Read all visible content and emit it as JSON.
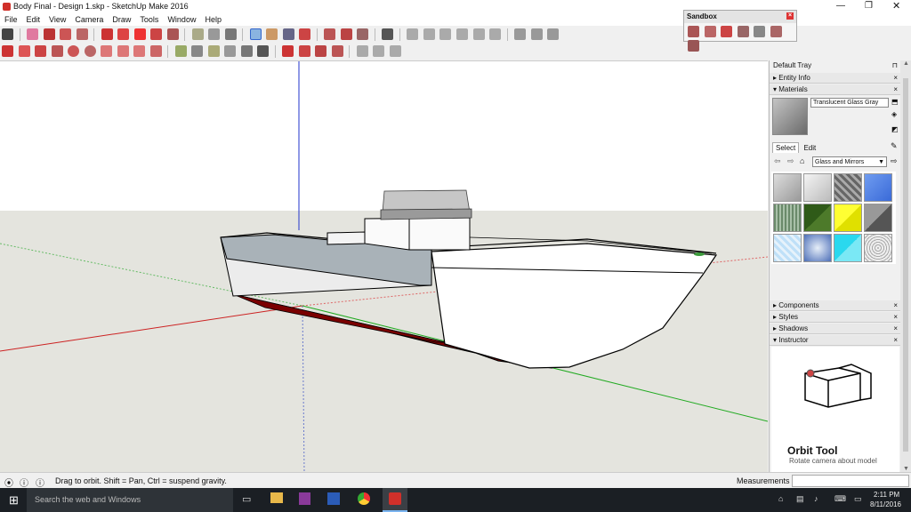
{
  "window": {
    "title": "Body Final - Design 1.skp - SketchUp Make 2016"
  },
  "menu": [
    "File",
    "Edit",
    "View",
    "Camera",
    "Draw",
    "Tools",
    "Window",
    "Help"
  ],
  "sandbox": {
    "title": "Sandbox"
  },
  "tray": {
    "title": "Default Tray",
    "entity_info": "Entity Info",
    "materials": "Materials",
    "material_name": "Translucent Glass Gray",
    "tab_select": "Select",
    "tab_edit": "Edit",
    "collection": "Glass and Mirrors",
    "components": "Components",
    "styles": "Styles",
    "shadows": "Shadows",
    "instructor": "Instructor",
    "instructor_title": "Orbit Tool",
    "instructor_desc": "Rotate camera about model"
  },
  "status": {
    "hint": "Drag to orbit. Shift = Pan, Ctrl = suspend gravity.",
    "measurements": "Measurements"
  },
  "taskbar": {
    "search": "Search the web and Windows",
    "time": "2:11 PM",
    "date": "8/11/2016"
  },
  "colors": {
    "hull_bottom": "#7a0000",
    "axis_red": "#cc0000",
    "axis_green": "#00a000",
    "axis_blue": "#0000cc"
  }
}
